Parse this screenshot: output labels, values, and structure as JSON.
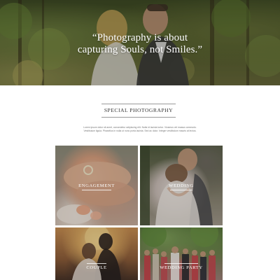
{
  "hero": {
    "quote_line1": "“Photography is about",
    "quote_line2": "capturing Souls, not Smiles.”"
  },
  "section": {
    "title": "SPECIAL PHOTOGRAPHY",
    "intro": "Lorem ipsum dolor sit amet, consectetur adipiscing elit. Nulla id lacinia tortor. Vivamus vel massa commodo. Vestibulum ligula. Phasellus in nulla ut nunc porta lacinia. Sed ac dolor. Integer vestibulum mauris at lectus."
  },
  "gallery": [
    {
      "label": "ENGAGEMENT"
    },
    {
      "label": "WEDDING"
    },
    {
      "label": "COUPLE"
    },
    {
      "label": "WEDDING PARTY"
    }
  ],
  "colors": {
    "accent_text": "#333333",
    "rule": "#9a9a9a"
  }
}
